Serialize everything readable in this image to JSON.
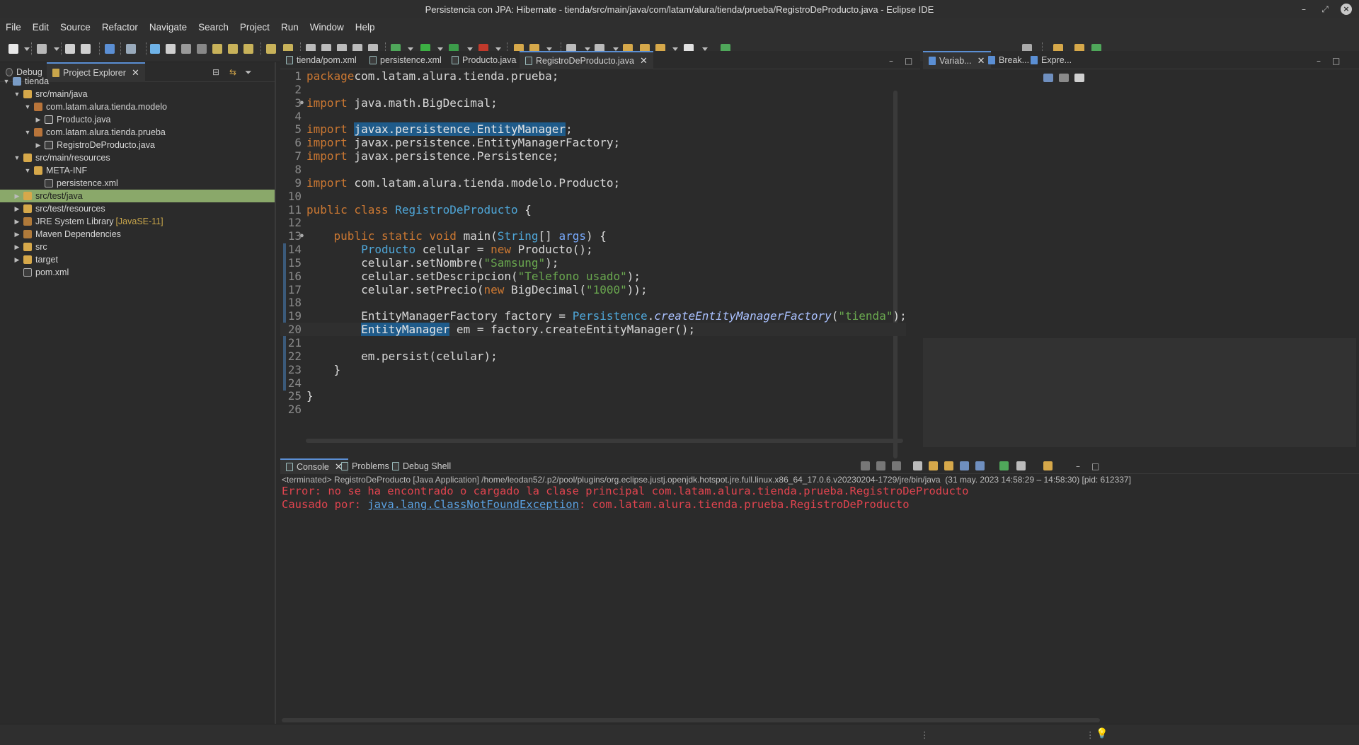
{
  "window": {
    "title": "Persistencia con JPA: Hibernate - tienda/src/main/java/com/latam/alura/tienda/prueba/RegistroDeProducto.java - Eclipse IDE"
  },
  "menu": [
    "File",
    "Edit",
    "Source",
    "Refactor",
    "Navigate",
    "Search",
    "Project",
    "Run",
    "Window",
    "Help"
  ],
  "left_tabs": {
    "debug": "Debug",
    "explorer": "Project Explorer"
  },
  "tree": [
    {
      "label": "tienda",
      "extra": "",
      "level": 0,
      "twisty": "▼",
      "icon": "project-icon",
      "kind": "project",
      "selected": false
    },
    {
      "label": "src/main/java",
      "extra": "",
      "level": 1,
      "twisty": "▼",
      "icon": "source-folder-icon",
      "kind": "folder",
      "selected": false
    },
    {
      "label": "com.latam.alura.tienda.modelo",
      "extra": "",
      "level": 2,
      "twisty": "▼",
      "icon": "package-icon",
      "kind": "pkg",
      "selected": false
    },
    {
      "label": "Producto.java",
      "extra": "",
      "level": 3,
      "twisty": "▶",
      "icon": "java-file-icon",
      "kind": "java",
      "selected": false
    },
    {
      "label": "com.latam.alura.tienda.prueba",
      "extra": "",
      "level": 2,
      "twisty": "▼",
      "icon": "package-icon",
      "kind": "pkg",
      "selected": false
    },
    {
      "label": "RegistroDeProducto.java",
      "extra": "",
      "level": 3,
      "twisty": "▶",
      "icon": "java-file-icon",
      "kind": "java",
      "selected": false
    },
    {
      "label": "src/main/resources",
      "extra": "",
      "level": 1,
      "twisty": "▼",
      "icon": "source-folder-icon",
      "kind": "folder",
      "selected": false
    },
    {
      "label": "META-INF",
      "extra": "",
      "level": 2,
      "twisty": "▼",
      "icon": "folder-icon",
      "kind": "folder",
      "selected": false
    },
    {
      "label": "persistence.xml",
      "extra": "",
      "level": 3,
      "twisty": "",
      "icon": "xml-file-icon",
      "kind": "xml",
      "selected": false
    },
    {
      "label": "src/test/java",
      "extra": "",
      "level": 1,
      "twisty": "▶",
      "icon": "source-folder-icon",
      "kind": "folder",
      "selected": true
    },
    {
      "label": "src/test/resources",
      "extra": "",
      "level": 1,
      "twisty": "▶",
      "icon": "source-folder-icon",
      "kind": "folder",
      "selected": false
    },
    {
      "label": "JRE System Library",
      "extra": "[JavaSE-11]",
      "level": 1,
      "twisty": "▶",
      "icon": "library-icon",
      "kind": "lib",
      "selected": false
    },
    {
      "label": "Maven Dependencies",
      "extra": "",
      "level": 1,
      "twisty": "▶",
      "icon": "library-icon",
      "kind": "lib",
      "selected": false
    },
    {
      "label": "src",
      "extra": "",
      "level": 1,
      "twisty": "▶",
      "icon": "folder-icon",
      "kind": "folder",
      "selected": false
    },
    {
      "label": "target",
      "extra": "",
      "level": 1,
      "twisty": "▶",
      "icon": "folder-icon",
      "kind": "folder",
      "selected": false
    },
    {
      "label": "pom.xml",
      "extra": "",
      "level": 1,
      "twisty": "",
      "icon": "xml-file-icon",
      "kind": "xml",
      "selected": false
    }
  ],
  "editor_tabs": [
    {
      "label": "tienda/pom.xml",
      "active": false
    },
    {
      "label": "persistence.xml",
      "active": false
    },
    {
      "label": "Producto.java",
      "active": false
    },
    {
      "label": "RegistroDeProducto.java",
      "active": true
    }
  ],
  "code": {
    "current_line": 20,
    "lines": [
      [
        [
          "kw",
          "package"
        ],
        [
          "",
          "com.latam.alura.tienda.prueba;"
        ]
      ],
      [],
      [
        [
          "kw",
          "import"
        ],
        [
          "",
          " java.math.BigDecimal;"
        ]
      ],
      [],
      [
        [
          "kw",
          "import"
        ],
        [
          "",
          " "
        ],
        [
          "occ",
          "javax.persistence.EntityManager"
        ],
        [
          "",
          ";"
        ]
      ],
      [
        [
          "kw",
          "import"
        ],
        [
          "",
          " javax.persistence.EntityManagerFactory;"
        ]
      ],
      [
        [
          "kw",
          "import"
        ],
        [
          "",
          " javax.persistence.Persistence;"
        ]
      ],
      [],
      [
        [
          "kw",
          "import"
        ],
        [
          "",
          " com.latam.alura.tienda.modelo.Producto;"
        ]
      ],
      [],
      [
        [
          "kw",
          "public class"
        ],
        [
          "",
          " "
        ],
        [
          "ty",
          "RegistroDeProducto"
        ],
        [
          "",
          " {"
        ]
      ],
      [],
      [
        [
          "",
          "    "
        ],
        [
          "kw",
          "public static void"
        ],
        [
          "",
          " "
        ],
        [
          "fn",
          "main"
        ],
        [
          "",
          "("
        ],
        [
          "ty",
          "String"
        ],
        [
          "",
          "[] "
        ],
        [
          "pm",
          "args"
        ],
        [
          "",
          ") {"
        ]
      ],
      [
        [
          "",
          "        "
        ],
        [
          "ty",
          "Producto"
        ],
        [
          "",
          " celular = "
        ],
        [
          "kw",
          "new"
        ],
        [
          "",
          " Producto();"
        ]
      ],
      [
        [
          "",
          "        celular.setNombre("
        ],
        [
          "str",
          "\"Samsung\""
        ],
        [
          "",
          ");"
        ]
      ],
      [
        [
          "",
          "        celular.setDescripcion("
        ],
        [
          "str",
          "\"Telefono usado\""
        ],
        [
          "",
          ");"
        ]
      ],
      [
        [
          "",
          "        celular.setPrecio("
        ],
        [
          "kw",
          "new"
        ],
        [
          "",
          " BigDecimal("
        ],
        [
          "str",
          "\"1000\""
        ],
        [
          "",
          "));"
        ]
      ],
      [],
      [
        [
          "",
          "        EntityManagerFactory factory = "
        ],
        [
          "ty",
          "Persistence"
        ],
        [
          "",
          "."
        ],
        [
          "mcall",
          "createEntityManagerFactory"
        ],
        [
          "",
          "("
        ],
        [
          "str",
          "\"tienda\""
        ],
        [
          "",
          ");"
        ]
      ],
      [
        [
          "",
          "        "
        ],
        [
          "occ",
          "EntityManager"
        ],
        [
          "",
          " em = factory.createEntityManager();"
        ]
      ],
      [],
      [
        [
          "",
          "        em.persist(celular);"
        ]
      ],
      [
        [
          "",
          "    }"
        ]
      ],
      [],
      [
        [
          "",
          "}"
        ]
      ],
      []
    ]
  },
  "right_tabs": [
    {
      "label": "Variab...",
      "active": true,
      "icon": "variables-icon"
    },
    {
      "label": "Break...",
      "active": false,
      "icon": "breakpoints-icon"
    },
    {
      "label": "Expre...",
      "active": false,
      "icon": "expressions-icon"
    }
  ],
  "console_tabs": [
    {
      "label": "Console",
      "active": true,
      "icon": "console-icon"
    },
    {
      "label": "Problems",
      "active": false,
      "icon": "problems-icon"
    },
    {
      "label": "Debug Shell",
      "active": false,
      "icon": "debug-shell-icon"
    }
  ],
  "console": {
    "header": "<terminated> RegistroDeProducto [Java Application] /home/leodan52/.p2/pool/plugins/org.eclipse.justj.openjdk.hotspot.jre.full.linux.x86_64_17.0.6.v20230204-1729/jre/bin/java  (31 may. 2023 14:58:29 – 14:58:30) [pid: 612337]",
    "error_line": "Error: no se ha encontrado o cargado la clase principal com.latam.alura.tienda.prueba.RegistroDeProducto",
    "cause_prefix": "Causado por: ",
    "cause_link": "java.lang.ClassNotFoundException",
    "cause_suffix": ": com.latam.alura.tienda.prueba.RegistroDeProducto"
  },
  "colors": {
    "accent": "#5b8fd4",
    "selection": "#8aa86a",
    "error": "#e0444f",
    "keyword": "#cc7832",
    "string": "#6aa84f"
  }
}
